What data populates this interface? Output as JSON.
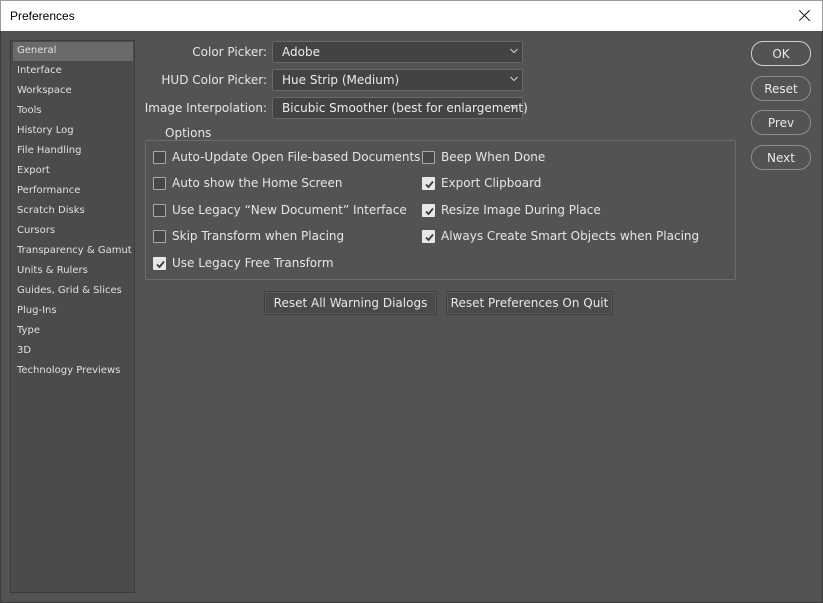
{
  "window": {
    "title": "Preferences"
  },
  "sidebar": {
    "items": [
      {
        "label": "General",
        "selected": true
      },
      {
        "label": "Interface"
      },
      {
        "label": "Workspace"
      },
      {
        "label": "Tools"
      },
      {
        "label": "History Log"
      },
      {
        "label": "File Handling"
      },
      {
        "label": "Export"
      },
      {
        "label": "Performance"
      },
      {
        "label": "Scratch Disks"
      },
      {
        "label": "Cursors"
      },
      {
        "label": "Transparency & Gamut"
      },
      {
        "label": "Units & Rulers"
      },
      {
        "label": "Guides, Grid & Slices"
      },
      {
        "label": "Plug-Ins"
      },
      {
        "label": "Type"
      },
      {
        "label": "3D"
      },
      {
        "label": "Technology Previews"
      }
    ]
  },
  "fields": {
    "color_picker": {
      "label": "Color Picker:",
      "value": "Adobe"
    },
    "hud_color_picker": {
      "label": "HUD Color Picker:",
      "value": "Hue Strip (Medium)"
    },
    "image_interpolation": {
      "label": "Image Interpolation:",
      "value": "Bicubic Smoother (best for enlargement)"
    }
  },
  "options": {
    "title": "Options",
    "left": [
      {
        "label": "Auto-Update Open File-based Documents",
        "checked": false
      },
      {
        "label": "Auto show the Home Screen",
        "checked": false
      },
      {
        "label": "Use Legacy “New Document” Interface",
        "checked": false
      },
      {
        "label": "Skip Transform when Placing",
        "checked": false
      },
      {
        "label": "Use Legacy Free Transform",
        "checked": true
      }
    ],
    "right": [
      {
        "label": "Beep When Done",
        "checked": false
      },
      {
        "label": "Export Clipboard",
        "checked": true
      },
      {
        "label": "Resize Image During Place",
        "checked": true
      },
      {
        "label": "Always Create Smart Objects when Placing",
        "checked": true
      }
    ]
  },
  "buttons": {
    "reset_warnings": "Reset All Warning Dialogs",
    "reset_on_quit": "Reset Preferences On Quit",
    "ok": "OK",
    "reset": "Reset",
    "prev": "Prev",
    "next": "Next"
  },
  "icons": {
    "close": "close-icon",
    "dropdown": "chevron-down-icon",
    "check": "checkmark-icon"
  }
}
